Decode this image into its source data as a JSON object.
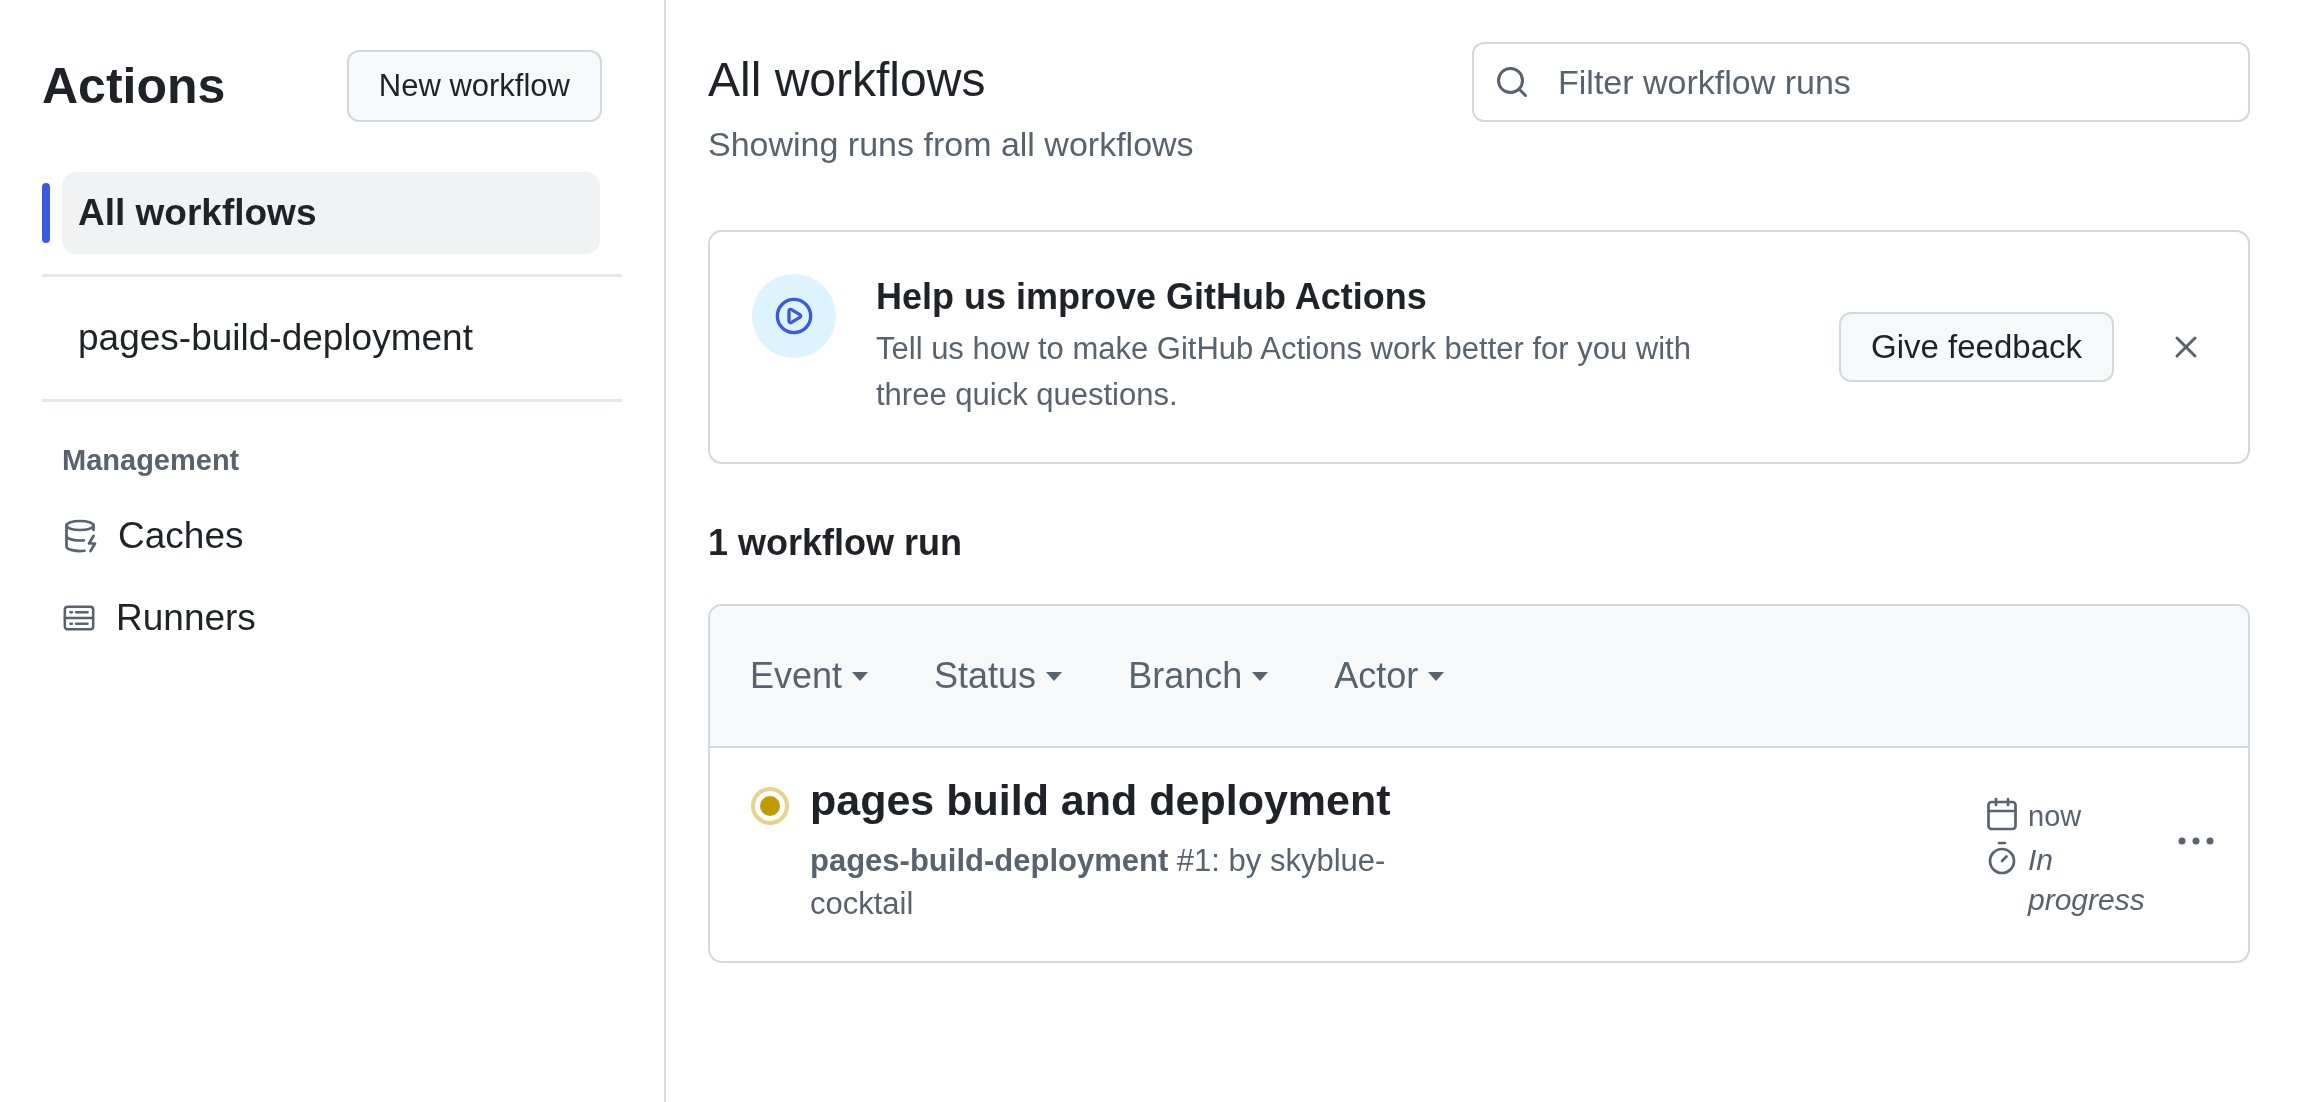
{
  "sidebar": {
    "title": "Actions",
    "new_button": "New workflow",
    "workflows": [
      {
        "label": "All workflows",
        "selected": true
      },
      {
        "label": "pages-build-deployment",
        "selected": false
      }
    ],
    "section_heading": "Management",
    "management": [
      {
        "label": "Caches",
        "kind": "caches"
      },
      {
        "label": "Runners",
        "kind": "runners"
      }
    ]
  },
  "main": {
    "title": "All workflows",
    "subtitle": "Showing runs from all workflows",
    "filter": {
      "placeholder": "Filter workflow runs"
    },
    "banner": {
      "title": "Help us improve GitHub Actions",
      "text": "Tell us how to make GitHub Actions work better for you with three quick questions.",
      "button": "Give feedback"
    },
    "run_count": "1 workflow run",
    "filters": [
      "Event",
      "Status",
      "Branch",
      "Actor"
    ],
    "runs": [
      {
        "kind": "in_progress",
        "title": "pages build and deployment",
        "detail": "**pages-build-deployment** #1: by skyblue-cocktail",
        "date": "now",
        "duration": "In progress"
      }
    ]
  }
}
